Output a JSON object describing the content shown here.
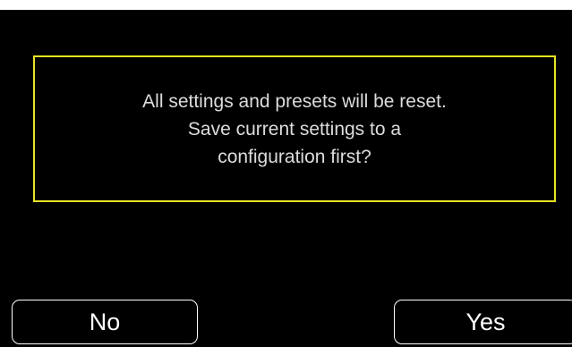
{
  "dialog": {
    "message_lines": [
      "All settings and presets will be reset.",
      "Save current settings to a",
      "configuration first?"
    ],
    "border_color": "#e8e324",
    "background_color": "#000000"
  },
  "buttons": {
    "no_label": "No",
    "yes_label": "Yes"
  }
}
